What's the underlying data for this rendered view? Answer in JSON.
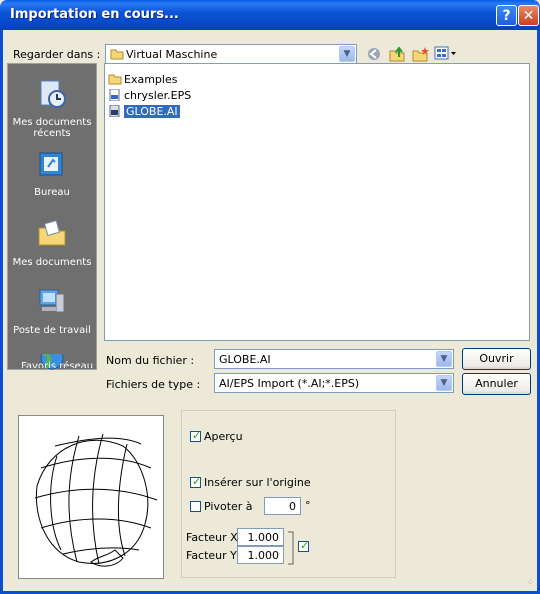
{
  "window": {
    "title": "Importation en cours..."
  },
  "toolbar": {
    "look_in_label": "Regarder dans :",
    "look_in_value": "Virtual Maschine"
  },
  "places": [
    {
      "label": "Mes documents récents",
      "icon": "recent-documents-icon"
    },
    {
      "label": "Bureau",
      "icon": "desktop-icon"
    },
    {
      "label": "Mes documents",
      "icon": "my-documents-icon"
    },
    {
      "label": "Poste de travail",
      "icon": "my-computer-icon"
    },
    {
      "label": "Favoris réseau",
      "icon": "network-places-icon"
    }
  ],
  "files": [
    {
      "name": "Examples",
      "type": "folder"
    },
    {
      "name": "chrysler.EPS",
      "type": "eps"
    },
    {
      "name": "GLOBE.AI",
      "type": "ai",
      "selected": true
    }
  ],
  "filename": {
    "label": "Nom du fichier :",
    "value": "GLOBE.AI"
  },
  "filetype": {
    "label": "Fichiers de type :",
    "value": "AI/EPS Import (*.AI;*.EPS)"
  },
  "buttons": {
    "open": "Ouvrir",
    "cancel": "Annuler"
  },
  "options": {
    "preview_label": "Aperçu",
    "preview_checked": true,
    "origin_label": "Insérer sur l'origine",
    "origin_checked": true,
    "rotate_label": "Pivoter à",
    "rotate_checked": false,
    "rotate_value": "0",
    "rotate_unit": "°",
    "factor_x_label": "Facteur X",
    "factor_x_value": "1.000",
    "factor_y_label": "Facteur Y",
    "factor_y_value": "1.000",
    "lock_checked": true
  }
}
